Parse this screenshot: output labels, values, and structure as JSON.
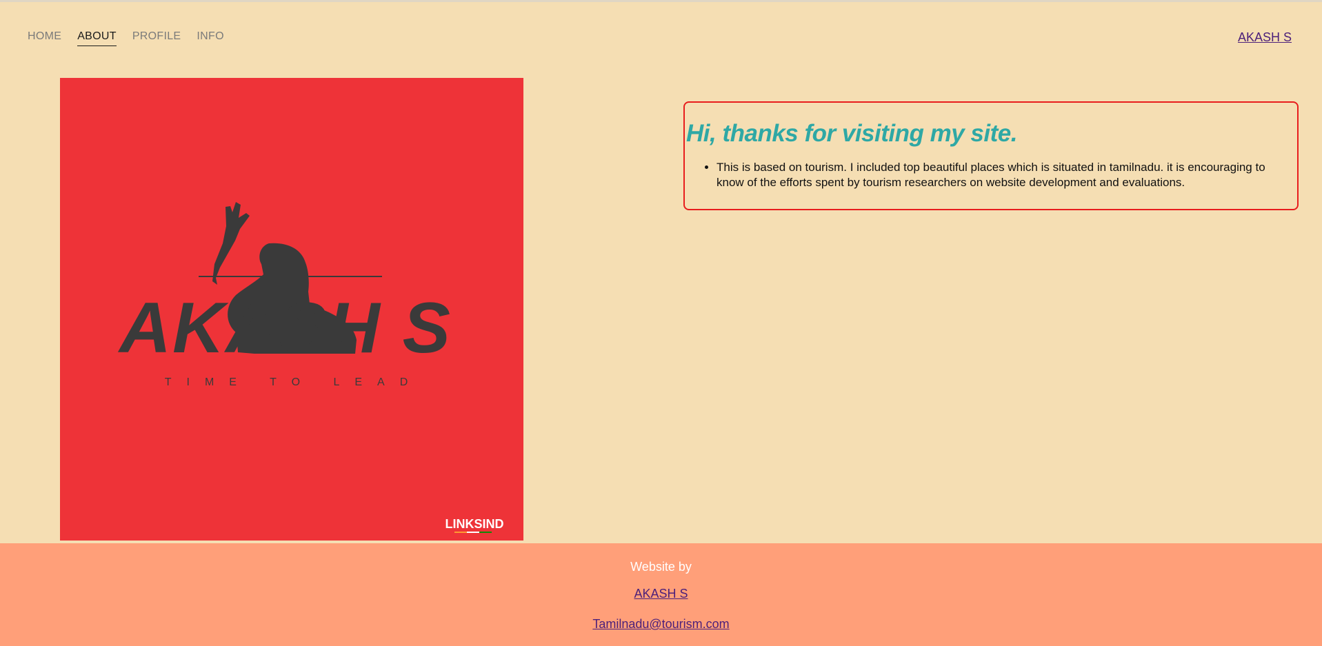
{
  "nav": {
    "items": [
      {
        "label": "HOME"
      },
      {
        "label": "ABOUT"
      },
      {
        "label": "PROFILE"
      },
      {
        "label": "INFO"
      }
    ],
    "active": "ABOUT"
  },
  "header": {
    "brand_link": "AKASH S"
  },
  "hero": {
    "logo_name": "AKASH S",
    "logo_tagline": "TIME TO LEAD",
    "watermark": "LINKSIND",
    "background_color": "#ee3338"
  },
  "intro": {
    "title": "Hi, thanks for visiting my site.",
    "bullets": [
      "This is based on tourism. I included top beautiful places which is situated in tamilnadu. it is encouraging to know of the efforts spent by tourism researchers on website development and evaluations."
    ]
  },
  "footer": {
    "credit": "Website by",
    "name_link": "AKASH S",
    "email_link": "Tamilnadu@tourism.com"
  },
  "colors": {
    "page_bg": "#f5deb3",
    "footer_bg": "#ff9f79",
    "title_teal": "#2ea8a5",
    "box_border": "#e81c1c",
    "link_purple": "#4b1f7a"
  }
}
